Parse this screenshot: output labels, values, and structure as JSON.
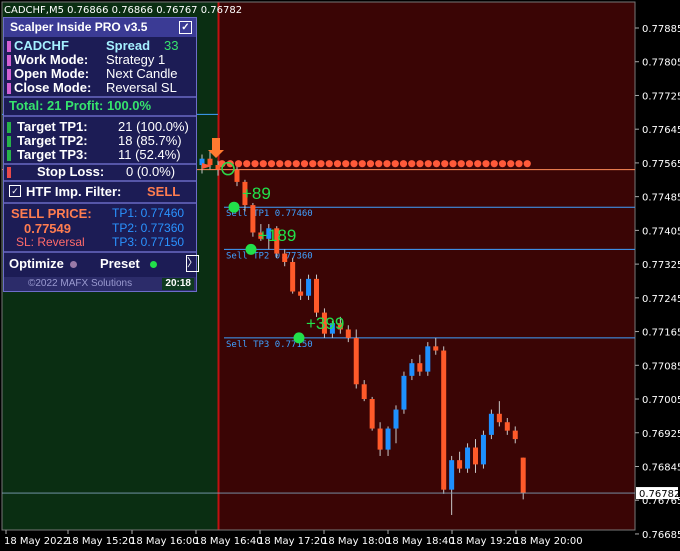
{
  "symbol_header": "CADCHF,M5  0.76866 0.76866 0.76767 0.76782",
  "panel": {
    "title": "Scalper Inside PRO v3.5",
    "checkbox": "☑",
    "symbol": "CADCHF",
    "spread_label": "Spread",
    "spread_value": "33",
    "work_mode_label": "Work  Mode:",
    "work_mode_value": "Strategy 1",
    "open_mode_label": "Open  Mode:",
    "open_mode_value": "Next Candle",
    "close_mode_label": "Close Mode:",
    "close_mode_value": "Reversal SL",
    "total": "Total: 21  Profit: 100.0%",
    "tp1_label": "Target TP1:",
    "tp1_value": "21 (100.0%)",
    "tp2_label": "Target TP2:",
    "tp2_value": "18 (85.7%)",
    "tp3_label": "Target TP3:",
    "tp3_value": "11 (52.4%)",
    "sl_label": "Stop Loss:",
    "sl_value": "0 (0.0%)",
    "htf_label": "HTF Imp. Filter:",
    "htf_value": "SELL",
    "sell_price_label": "SELL PRICE:",
    "sell_price_value": "0.77549",
    "sl_mode": "SL: Reversal",
    "tp1_price": "TP1: 0.77460",
    "tp2_price": "TP2: 0.77360",
    "tp3_price": "TP3: 0.77150",
    "optimize": "Optimize",
    "preset": "Preset",
    "chevron": "〉",
    "copyright": "©2022 MAFX Solutions",
    "time": "20:18"
  },
  "price_axis": [
    "0.77885",
    "0.77805",
    "0.77725",
    "0.77645",
    "0.77565",
    "0.77485",
    "0.77405",
    "0.77325",
    "0.77245",
    "0.77165",
    "0.77085",
    "0.77005",
    "0.76925",
    "0.76845",
    "0.76765",
    "0.76685"
  ],
  "current_price": "0.76782",
  "time_axis": [
    "18 May 2022",
    "18 May 15:20",
    "18 May 16:00",
    "18 May 16:40",
    "18 May 17:20",
    "18 May 18:00",
    "18 May 18:40",
    "18 May 19:20",
    "18 May 20:00"
  ],
  "chart_labels": {
    "tp1_line": "Sell TP1 0.77460",
    "tp2_line": "Sell TP2 0.77360",
    "tp3_line": "Sell TP3 0.77150",
    "pips1": "+89",
    "pips2": "+189",
    "pips3": "+399"
  },
  "colors": {
    "bull": "#1e90ff",
    "bear": "#ff5a2a",
    "green_zone": "#0a2e12",
    "red_zone": "#3a0505",
    "tp_line": "#3fa0ff",
    "entry_line": "#ff8c5a"
  },
  "candles": [
    [
      0.77549,
      0.7756,
      0.7751,
      0.7752
    ],
    [
      0.7752,
      0.77525,
      0.7745,
      0.77465
    ],
    [
      0.77465,
      0.7747,
      0.7739,
      0.774
    ],
    [
      0.774,
      0.7742,
      0.7738,
      0.77385
    ],
    [
      0.77385,
      0.7742,
      0.7736,
      0.7741
    ],
    [
      0.7741,
      0.77415,
      0.7734,
      0.7735
    ],
    [
      0.7735,
      0.7736,
      0.7732,
      0.7733
    ],
    [
      0.7733,
      0.7734,
      0.77255,
      0.7726
    ],
    [
      0.7726,
      0.7729,
      0.7724,
      0.7725
    ],
    [
      0.7725,
      0.773,
      0.7724,
      0.7729
    ],
    [
      0.7729,
      0.773,
      0.772,
      0.7721
    ],
    [
      0.7721,
      0.7722,
      0.7715,
      0.7716
    ],
    [
      0.7716,
      0.7719,
      0.7715,
      0.77185
    ],
    [
      0.77185,
      0.772,
      0.7716,
      0.7717
    ],
    [
      0.7717,
      0.7718,
      0.7714,
      0.7715
    ],
    [
      0.7715,
      0.7717,
      0.7703,
      0.7704
    ],
    [
      0.7704,
      0.7705,
      0.77,
      0.77005
    ],
    [
      0.77005,
      0.7701,
      0.7693,
      0.76935
    ],
    [
      0.76935,
      0.7695,
      0.7687,
      0.76885
    ],
    [
      0.76885,
      0.7694,
      0.7687,
      0.76935
    ],
    [
      0.76935,
      0.7699,
      0.769,
      0.7698
    ],
    [
      0.7698,
      0.7707,
      0.7697,
      0.7706
    ],
    [
      0.7706,
      0.771,
      0.7705,
      0.7709
    ],
    [
      0.7709,
      0.7711,
      0.7706,
      0.7707
    ],
    [
      0.7707,
      0.7714,
      0.7706,
      0.7713
    ],
    [
      0.7713,
      0.7715,
      0.7711,
      0.7712
    ],
    [
      0.7712,
      0.7713,
      0.7678,
      0.7679
    ],
    [
      0.7679,
      0.7687,
      0.7673,
      0.7686
    ],
    [
      0.7686,
      0.7688,
      0.7683,
      0.7684
    ],
    [
      0.7684,
      0.769,
      0.7683,
      0.7689
    ],
    [
      0.7689,
      0.7691,
      0.7683,
      0.7685
    ],
    [
      0.7685,
      0.7693,
      0.7684,
      0.7692
    ],
    [
      0.7692,
      0.7698,
      0.7691,
      0.7697
    ],
    [
      0.7697,
      0.77,
      0.7694,
      0.7695
    ],
    [
      0.7695,
      0.7696,
      0.7692,
      0.7693
    ],
    [
      0.7693,
      0.7694,
      0.769,
      0.7691
    ],
    [
      0.76866,
      0.76866,
      0.76767,
      0.76782
    ]
  ]
}
